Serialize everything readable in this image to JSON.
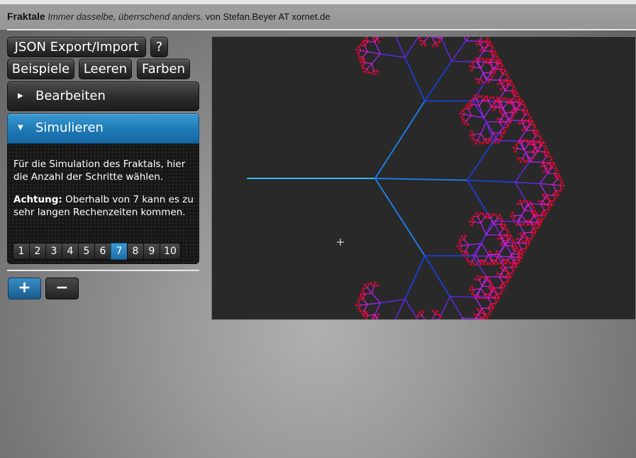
{
  "header": {
    "title": "Fraktale",
    "tagline": "Immer dasselbe, überrschend anders.",
    "author": "von Stefan.Beyer AT xornet.de"
  },
  "toolbar": {
    "json_label": "JSON Export/Import",
    "help_label": "?",
    "examples_label": "Beispiele",
    "clear_label": "Leeren",
    "colors_label": "Farben"
  },
  "accordion": {
    "edit": {
      "label": "Bearbeiten",
      "expanded": false
    },
    "simulate": {
      "label": "Simulieren",
      "expanded": true
    }
  },
  "simulate_panel": {
    "intro": "Für die Simulation des Fraktals, hier die Anzahl der Schritte wählen.",
    "warning_label": "Achtung:",
    "warning_text": "Oberhalb von 7 kann es zu sehr langen Rechenzeiten kommen.",
    "steps": [
      "1",
      "2",
      "3",
      "4",
      "5",
      "6",
      "7",
      "8",
      "9",
      "10"
    ],
    "selected_step": "7"
  },
  "controls": {
    "plus_label": "+",
    "minus_label": "−"
  },
  "colors": {
    "accent": "#1f7bb6",
    "canvas_bg": "#292929",
    "trunk": "#36b8ef",
    "leaf": "#ff0033"
  },
  "fractal": {
    "depth": 7,
    "trunk_color": "#36b8ef",
    "palette": [
      "#36b8ef",
      "#1f7ae0",
      "#1c3fd8",
      "#5a28d8",
      "#9a25e6",
      "#d21ed8",
      "#f0148a",
      "#ff0026"
    ]
  }
}
